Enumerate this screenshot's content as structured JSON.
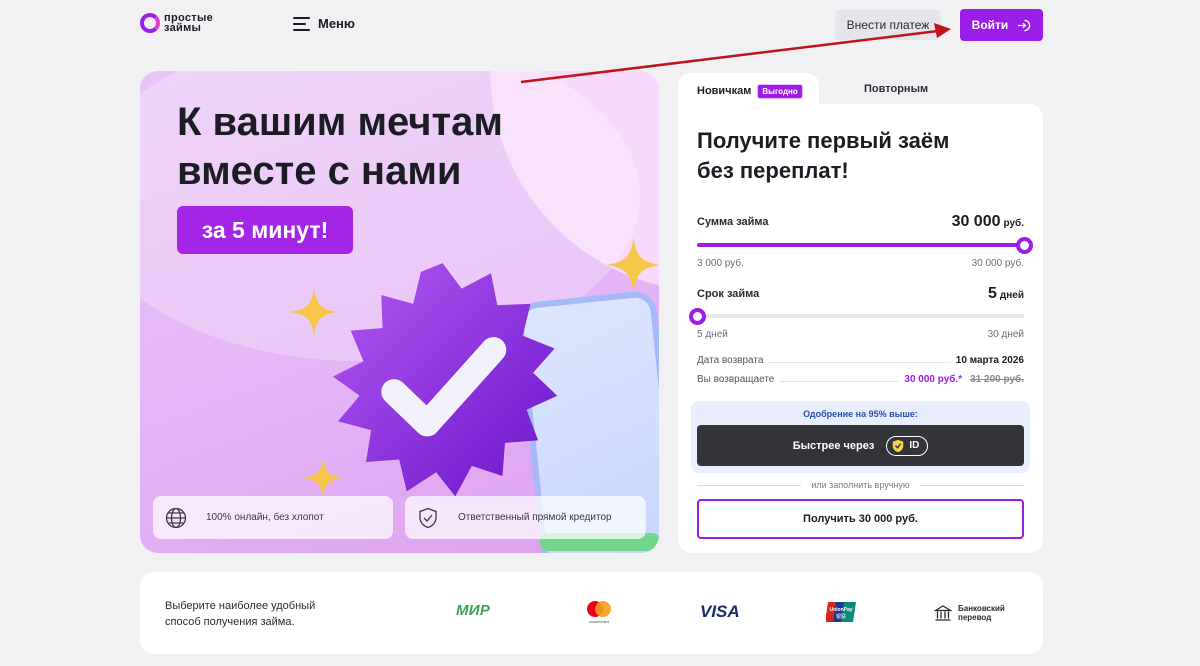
{
  "header": {
    "logo_line1": "простые",
    "logo_line2": "займы",
    "menu_label": "Меню",
    "pay_button": "Внести платеж",
    "login_button": "Войти"
  },
  "hero": {
    "title_line1": "К вашим мечтам",
    "title_line2": "вместе с нами",
    "badge": "за 5 минут!",
    "features": [
      {
        "icon": "globe-icon",
        "text": "100% онлайн, без хлопот"
      },
      {
        "icon": "shield-check-icon",
        "text": "Ответственный прямой кредитор"
      }
    ]
  },
  "tabs": {
    "active_label": "Новичкам",
    "active_tag": "Выгодно",
    "inactive_label": "Повторным"
  },
  "form": {
    "title_line1": "Получите первый заём",
    "title_line2": "без переплат!",
    "amount": {
      "label": "Сумма займа",
      "value": "30 000",
      "unit": "руб.",
      "min": "3 000 руб.",
      "max": "30 000 руб.",
      "fraction": 1.0
    },
    "term": {
      "label": "Срок займа",
      "value": "5",
      "unit": "дней",
      "min": "5 дней",
      "max": "30 дней",
      "fraction": 0.0
    },
    "return_date_label": "Дата возврата",
    "return_date_value": "10 марта 2026",
    "return_sum_label": "Вы возвращаете",
    "return_sum_new": "30 000 руб.*",
    "return_sum_old": "31 200 руб.",
    "approval_text": "Одобрение на 95% выше:",
    "fast_button": "Быстрее через",
    "id_label": "ID",
    "or_text": "или заполнить вручную",
    "get_button": "Получить 30 000 руб."
  },
  "payments": {
    "text_line1": "Выберите наиболее удобный",
    "text_line2": "способ получения займа.",
    "methods": {
      "mir": "МИР",
      "mastercard_caption": "mastercard",
      "visa": "VISA",
      "unionpay_caption": "UnionPay",
      "unionpay_cn": "银联",
      "bank_line1": "Банковский",
      "bank_line2": "перевод"
    }
  },
  "colors": {
    "accent": "#9b1ee8",
    "annotation_arrow": "#c0141c"
  }
}
